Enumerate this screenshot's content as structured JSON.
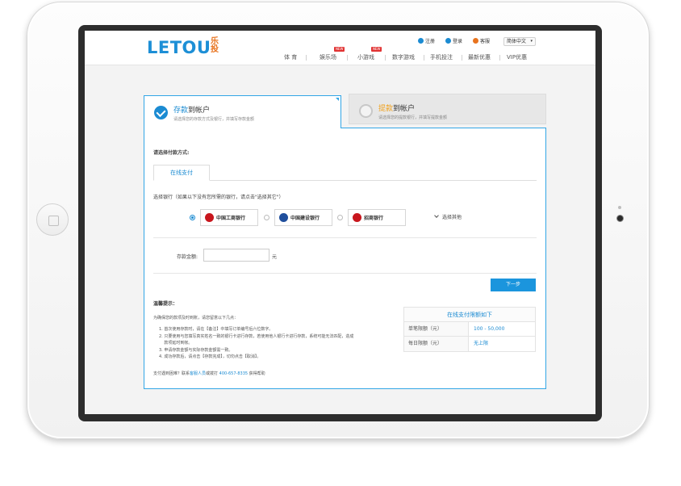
{
  "brand": {
    "logo_text": "LETOU",
    "logo_cn": "乐投",
    "accent": "#1b8bd2",
    "logo_orange": "#e8731e"
  },
  "header": {
    "utility": [
      {
        "label": "注册",
        "icon": "register-icon"
      },
      {
        "label": "登录",
        "icon": "user-icon"
      },
      {
        "label": "客服",
        "icon": "headset-icon"
      }
    ],
    "language": "简体中文",
    "nav": [
      {
        "label": "体 育"
      },
      {
        "label": "娱乐场",
        "badge": "NEW"
      },
      {
        "label": "小游戏",
        "badge": "NEW"
      },
      {
        "label": "数字游戏"
      },
      {
        "label": "手机投注"
      },
      {
        "label": "最新优惠"
      },
      {
        "label": "VIP优惠"
      }
    ]
  },
  "tabs": {
    "deposit": {
      "title_hl": "存款",
      "title_rest": "到帐户",
      "subtitle": "请选择您的存款方式及银行，并填写存款金额"
    },
    "withdraw": {
      "title_hl": "提款",
      "title_rest": "到帐户",
      "subtitle": "请选择您的提款银行，并填写提款金额"
    }
  },
  "form": {
    "method_label": "请选择付款方式:",
    "online_tab": "在线支付",
    "bank_label": "选择银行（如果以下没有您所需的银行，请点击\"选择其它\"）",
    "banks": [
      {
        "name": "中国工商银行",
        "color": "#c8161d",
        "selected": true
      },
      {
        "name": "中国建设银行",
        "color": "#1f4e9c",
        "selected": false
      },
      {
        "name": "招商银行",
        "color": "#c8161d",
        "selected": false
      }
    ],
    "more_label": "选择其他",
    "amount_label": "存款金额:",
    "amount_value": "",
    "amount_unit": "元",
    "next_button": "下一步"
  },
  "tips": {
    "title": "温馨提示：",
    "intro": "为确保您的款项及时到账，请您留意以下几点：",
    "items": [
      "1. 首次使用存款时，请在【备注】中填写订单编号后六位数字。",
      "2. 只要使用与您填写真实姓名一致的银行卡进行存款，若使用他人银行卡进行存款，系统可能无法匹配，造成",
      "    款项延时到帐。",
      "3. 申请存款金额与实际存款金额需一致。",
      "4. 成功存款后，请点击【存款完成】，切勿点击【取消】。"
    ],
    "footer_prefix": "支付遇到困难？联系",
    "footer_link": "客服人员",
    "footer_mid": "或拨打",
    "footer_phone": "400-657-8335",
    "footer_suffix": "获得帮助"
  },
  "limits": {
    "title": "在线支付限额如下",
    "rows": [
      {
        "label": "单笔限额（元）",
        "value": "100 - 50,000"
      },
      {
        "label": "每日限额（元）",
        "value": "无上限"
      }
    ]
  }
}
